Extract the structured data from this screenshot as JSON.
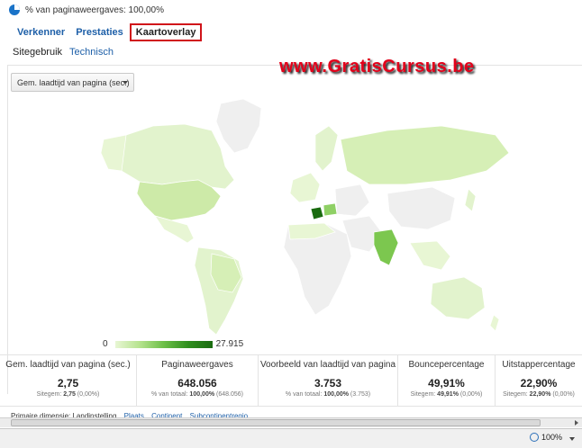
{
  "top": {
    "pageviews_label": "% van paginaweergaves: 100,00%"
  },
  "tabs": [
    {
      "label": "Verkenner"
    },
    {
      "label": "Prestaties"
    },
    {
      "label": "Kaartoverlay"
    }
  ],
  "subtabs": [
    {
      "label": "Sitegebruik"
    },
    {
      "label": "Technisch"
    }
  ],
  "watermark": "www.GratisCursus.be",
  "metric_select": {
    "value": "Gem. laadtijd van pagina (sec.)"
  },
  "legend": {
    "min": "0",
    "max": "27.915"
  },
  "metrics": [
    {
      "label": "Gem. laadtijd van pagina (sec.)",
      "value": "2,75",
      "sub_prefix": "Sitegem: ",
      "sub_bold": "2,75",
      "sub_suffix": " (0,00%)"
    },
    {
      "label": "Paginaweergaves",
      "value": "648.056",
      "sub_prefix": "% van totaal: ",
      "sub_bold": "100,00%",
      "sub_suffix": " (648.056)"
    },
    {
      "label": "Voorbeeld van laadtijd van pagina",
      "value": "3.753",
      "sub_prefix": "% van totaal: ",
      "sub_bold": "100,00%",
      "sub_suffix": " (3.753)"
    },
    {
      "label": "Bouncepercentage",
      "value": "49,91%",
      "sub_prefix": "Sitegem: ",
      "sub_bold": "49,91%",
      "sub_suffix": " (0,00%)"
    },
    {
      "label": "Uitstappercentage",
      "value": "22,90%",
      "sub_prefix": "Sitegem: ",
      "sub_bold": "22,90%",
      "sub_suffix": " (0,00%)"
    }
  ],
  "bottom": {
    "primary_label": "Primaire dimensie:",
    "primary_value": "Landinstelling",
    "links": [
      "Plaats",
      "Continent",
      "Subcontinentregio"
    ]
  },
  "status": {
    "zoom": "100%"
  },
  "colors": {
    "accent": "#1d5fa8",
    "highlight": "#d0141a",
    "map_dark": "#1a6b10",
    "map_light": "#e8f6d4",
    "no_data": "#efefef"
  }
}
